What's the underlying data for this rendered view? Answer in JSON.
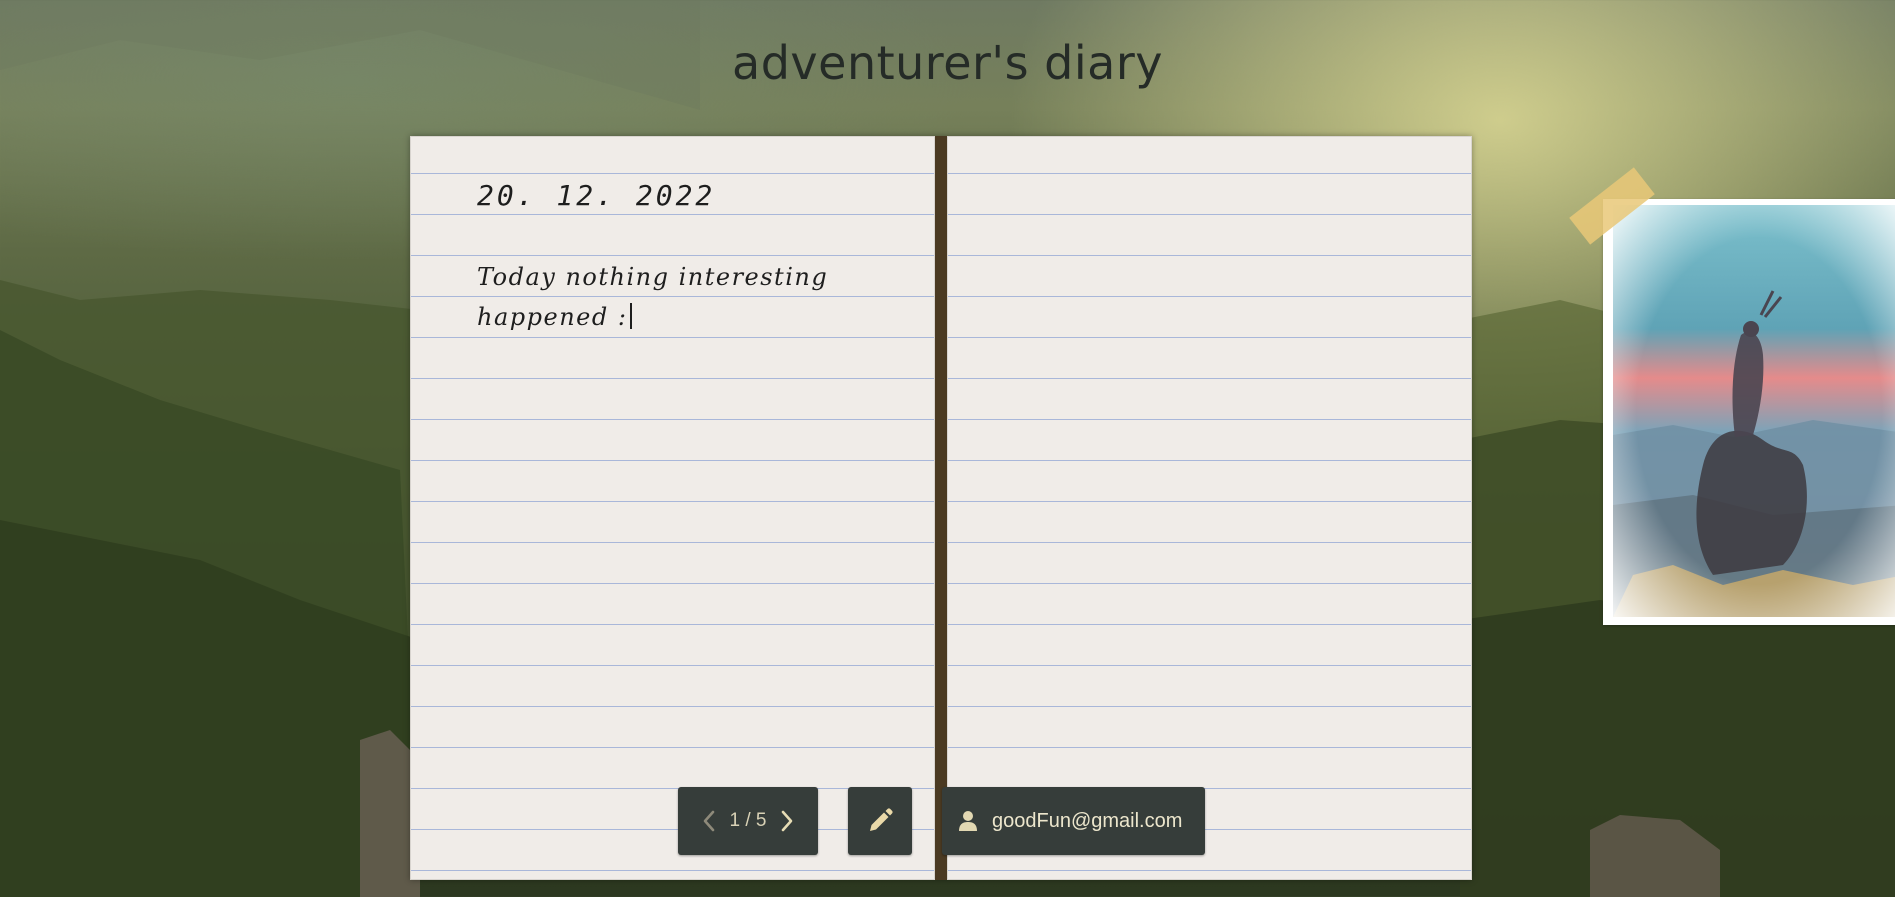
{
  "app": {
    "title": "adventurer's diary"
  },
  "entry": {
    "date": "20. 12. 2022",
    "text": "Today nothing interesting happened :"
  },
  "photo": {
    "description": "illustration of a rider on horseback at sunset"
  },
  "pagination": {
    "counter": "1 / 5"
  },
  "actions": {
    "edit_icon": "pencil-icon"
  },
  "user": {
    "email": "goodFun@gmail.com",
    "icon": "user-icon"
  },
  "colors": {
    "page": "#f0ece8",
    "rule_line": "#a9b7d9",
    "spine": "#4b3a22",
    "button_bg": "#363d3a",
    "button_text": "#d9d2b6",
    "tape": "#e9c878"
  }
}
